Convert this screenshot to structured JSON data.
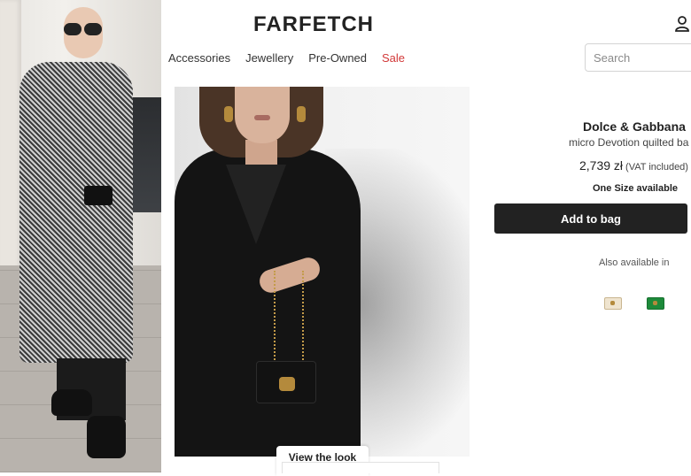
{
  "header": {
    "logo": "FARFETCH",
    "nav": [
      {
        "label": "Accessories"
      },
      {
        "label": "Jewellery"
      },
      {
        "label": "Pre-Owned"
      },
      {
        "label": "Sale",
        "color": "#d23838"
      }
    ],
    "search": {
      "placeholder": "Search",
      "value": ""
    },
    "account_icon": "user-icon"
  },
  "product": {
    "brand": "Dolce & Gabbana",
    "name": "micro Devotion quilted ba",
    "price": "2,739 zł",
    "vat_note": "(VAT included)",
    "size_note": "One Size available",
    "add_to_bag": "Add to bag",
    "also_available": "Also available in",
    "variants": [
      {
        "icon": "cream-bag-swatch",
        "color": "#efe4cf"
      },
      {
        "icon": "green-bag-swatch",
        "color": "#1d8a3a"
      }
    ]
  },
  "gallery": {
    "view_look": "View the look"
  },
  "colors": {
    "add_to_bag_bg": "#222222",
    "sale": "#d23838"
  }
}
